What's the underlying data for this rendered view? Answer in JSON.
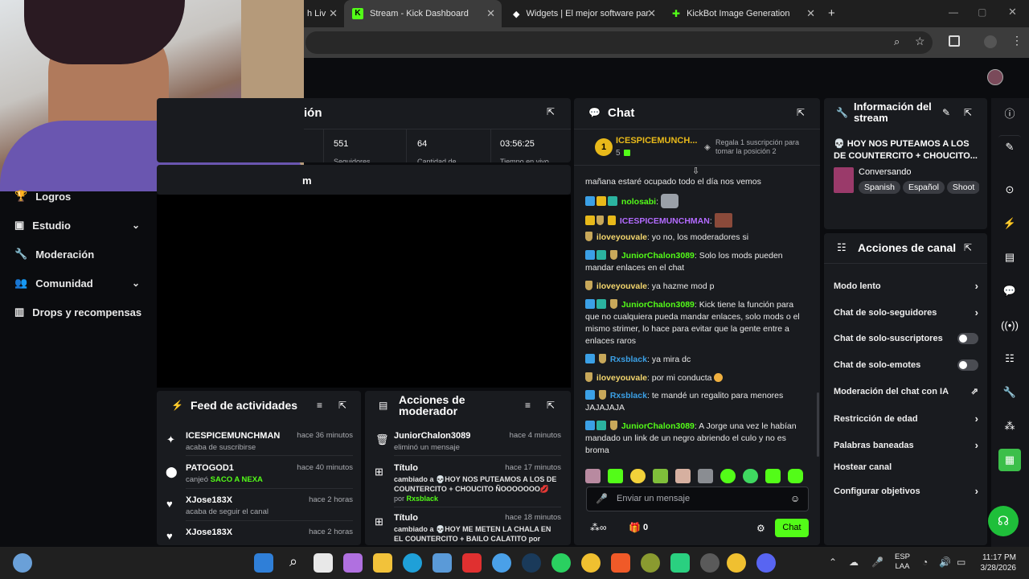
{
  "browser": {
    "tabs": [
      {
        "label": "h Liv",
        "active": false
      },
      {
        "label": "Stream - Kick Dashboard",
        "active": true
      },
      {
        "label": "Widgets | El mejor software par",
        "active": false
      },
      {
        "label": "KickBot Image Generation",
        "active": false
      }
    ],
    "new_tab": "+"
  },
  "sidebar": {
    "items": [
      {
        "label": "Logros",
        "icon": "trophy-icon"
      },
      {
        "label": "Estudio",
        "icon": "studio-icon",
        "expandable": true
      },
      {
        "label": "Moderación",
        "icon": "wrench-icon"
      },
      {
        "label": "Comunidad",
        "icon": "community-icon",
        "expandable": true
      },
      {
        "label": "Drops y recompensas",
        "icon": "chart-icon"
      }
    ]
  },
  "stats_panel": {
    "title_fragment": "ión",
    "stats": [
      "551",
      "64",
      "03:56:25"
    ],
    "stat_labels": [
      "Seguidores",
      "Cantidad de",
      "Tiempo en vivo"
    ],
    "second_title_fragment": "m"
  },
  "chat": {
    "title": "Chat",
    "top_gifter": {
      "rank": "1",
      "name": "ICESPICEMUNCH...",
      "count": "5"
    },
    "gift_prompt": "Regala 1 suscripción para tomar la posición 2",
    "messages": [
      {
        "user": "",
        "text": "mañana estaré ocupado todo el día nos vemos",
        "color": "#e9e9e9"
      },
      {
        "user": "nolosabi",
        "text": "",
        "color": "#53fc18"
      },
      {
        "user": "ICESPICEMUNCHMAN",
        "text": "",
        "color": "#b36bff"
      },
      {
        "user": "iloveyouvale",
        "text": "yo no, los moderadores si",
        "color": "#f5d76e"
      },
      {
        "user": "JuniorChalon3089",
        "text": "Solo los mods pueden mandar enlaces en el chat",
        "color": "#53fc18"
      },
      {
        "user": "iloveyouvale",
        "text": "ya hazme mod p",
        "color": "#f5d76e"
      },
      {
        "user": "JuniorChalon3089",
        "text": "Kick tiene la función para que no cualquiera pueda mandar enlaces, solo mods o el mismo strimer, lo hace para evitar que la gente entre a enlaces raros",
        "color": "#53fc18"
      },
      {
        "user": "Rxsblack",
        "text": "ya mira dc",
        "color": "#3ba0e6"
      },
      {
        "user": "iloveyouvale",
        "text": "por mi conducta",
        "color": "#f5d76e"
      },
      {
        "user": "Rxsblack",
        "text": "te mandé un regalito para menores JAJAJAJA",
        "color": "#3ba0e6"
      },
      {
        "user": "JuniorChalon3089",
        "text": "A Jorge una vez le habían mandado un link de un negro abriendo el culo y no es broma",
        "color": "#53fc18"
      }
    ],
    "input_placeholder": "Enviar un mensaje",
    "points_count": "0",
    "send_label": "Chat"
  },
  "stream_info": {
    "title": "Información del stream",
    "stream_title": "💀 HOY NOS PUTEAMOS A LOS DE COUNTERCITO + CHOUCITO...",
    "category": "Conversando",
    "tags": [
      "Spanish",
      "Español",
      "Shoot"
    ]
  },
  "channel_actions": {
    "title": "Acciones de canal",
    "items": [
      {
        "label": "Modo lento",
        "control": "chevron"
      },
      {
        "label": "Chat de solo-seguidores",
        "control": "chevron"
      },
      {
        "label": "Chat de solo-suscriptores",
        "control": "toggle"
      },
      {
        "label": "Chat de solo-emotes",
        "control": "toggle"
      },
      {
        "label": "Moderación del chat con IA",
        "control": "external"
      },
      {
        "label": "Restricción de edad",
        "control": "chevron"
      },
      {
        "label": "Palabras baneadas",
        "control": "chevron"
      },
      {
        "label": "Hostear canal",
        "control": "none"
      },
      {
        "label": "Configurar objetivos",
        "control": "chevron"
      }
    ]
  },
  "activity_feed": {
    "title": "Feed de actividades",
    "items": [
      {
        "name": "ICESPICEMUNCHMAN",
        "action": "acaba de suscribirse",
        "highlight": "",
        "time": "hace 36 minutos",
        "icon": "sparkle-icon"
      },
      {
        "name": "PATOGOD1",
        "action": "canjeó ",
        "highlight": "SACO A NEXA",
        "time": "hace 40 minutos",
        "icon": "points-icon"
      },
      {
        "name": "XJose183X",
        "action": "acaba de seguir el canal",
        "highlight": "",
        "time": "hace 2 horas",
        "icon": "heart-icon"
      },
      {
        "name": "XJose183X",
        "action": "",
        "highlight": "",
        "time": "hace 2 horas",
        "icon": "heart-icon"
      }
    ]
  },
  "mod_actions": {
    "title": "Acciones de moderador",
    "items": [
      {
        "name": "JuniorChalon3089",
        "action": "eliminó un mensaje",
        "by": "",
        "time": "hace 4 minutos",
        "icon": "trash-icon"
      },
      {
        "name": "Título",
        "action": "cambiado a 💀HOY NOS PUTEAMOS A LOS DE COUNTERCITO + CHOUCITO ÑOOOOOOO💋",
        "by": "Rxsblack",
        "time": "hace 17 minutos",
        "icon": "edit-title-icon"
      },
      {
        "name": "Título",
        "action": "cambiado a 💀HOY ME METEN LA CHALA EN EL COUNTERCITO + BAILO CALATITO por",
        "by": "",
        "time": "hace 18 minutos",
        "icon": "edit-title-icon"
      }
    ],
    "by_prefix": "por "
  },
  "taskbar": {
    "lang_top": "ESP",
    "lang_bottom": "LAA",
    "time": "11:17 PM",
    "date": "3/28/2026"
  }
}
